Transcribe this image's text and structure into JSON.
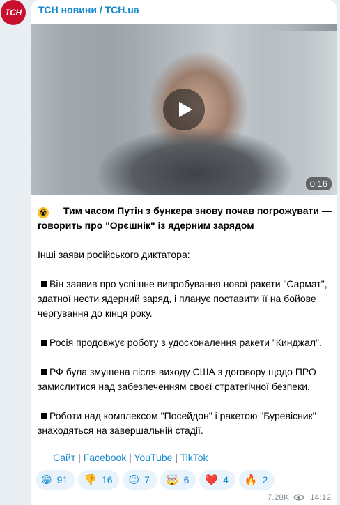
{
  "avatar": {
    "text": "ТСН"
  },
  "channel": {
    "name": "ТСН новини / TCH.ua"
  },
  "video": {
    "duration": "0:16"
  },
  "post": {
    "title": "Тим часом Путін з бункера знову почав погрожувати — говорить про \"Орєшнік\" із ядерним зарядом",
    "intro": "Інші заяви російського диктатора:",
    "bullets": [
      "Він заявив про успішне випробування нової ракети \"Сармат\", здатної нести ядерний заряд, і планує поставити її на бойове чергування до кінця року.",
      "Росія продовжує роботу з удосконалення ракети \"Кинджал\".",
      "РФ була змушена після виходу США з договору щодо ПРО замислитися над забезпеченням своєї стратегічної безпеки.",
      "Роботи над комплексом \"Посейдон\" і ракетою \"Буревісник\" знаходяться на завершальній стадії."
    ]
  },
  "links": [
    "Сайт",
    "Facebook",
    "YouTube",
    "TikTok"
  ],
  "reactions": [
    {
      "emoji": "😁",
      "count": "91"
    },
    {
      "emoji": "👎",
      "count": "16"
    },
    {
      "emoji": "😐",
      "count": "7"
    },
    {
      "emoji": "🤯",
      "count": "6"
    },
    {
      "emoji": "❤️",
      "count": "4"
    },
    {
      "emoji": "🔥",
      "count": "2"
    }
  ],
  "meta": {
    "views": "7.28K",
    "time": "14:12"
  },
  "colors": {
    "accent": "#168acd",
    "brand_red": "#c8102e"
  }
}
